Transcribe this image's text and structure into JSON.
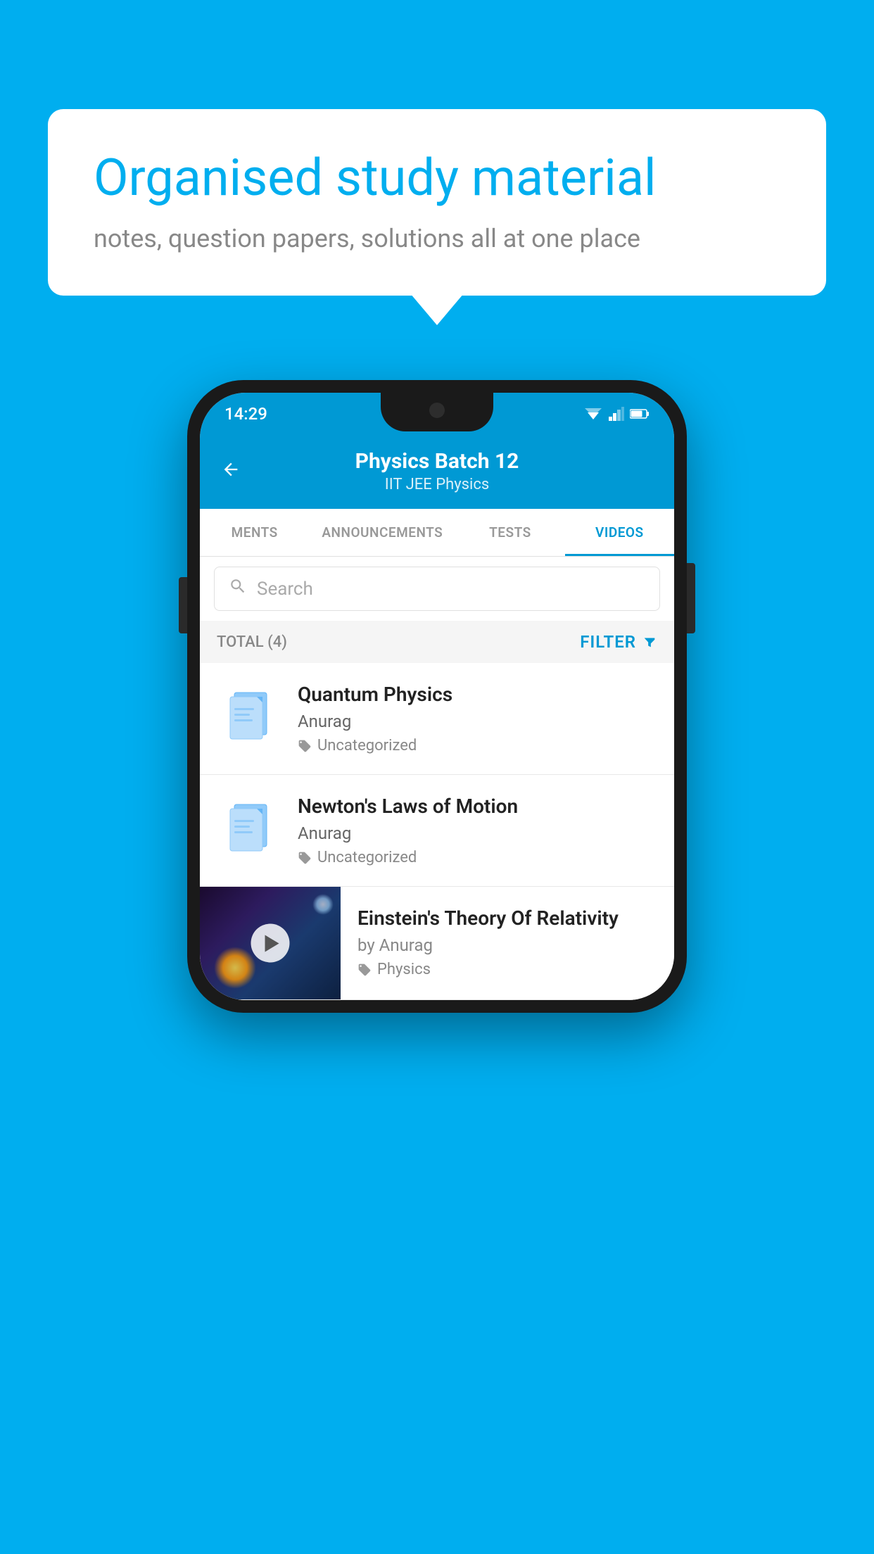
{
  "background_color": "#00AEEF",
  "bubble": {
    "title": "Organised study material",
    "subtitle": "notes, question papers, solutions all at one place"
  },
  "status_bar": {
    "time": "14:29"
  },
  "app_header": {
    "title": "Physics Batch 12",
    "subtitle_parts": [
      "IIT JEE",
      "Physics"
    ],
    "subtitle": "IIT JEE   Physics",
    "back_label": "←"
  },
  "tabs": [
    {
      "label": "MENTS",
      "active": false
    },
    {
      "label": "ANNOUNCEMENTS",
      "active": false
    },
    {
      "label": "TESTS",
      "active": false
    },
    {
      "label": "VIDEOS",
      "active": true
    }
  ],
  "search": {
    "placeholder": "Search"
  },
  "filter_bar": {
    "total_label": "TOTAL (4)",
    "filter_label": "FILTER"
  },
  "video_items": [
    {
      "id": 1,
      "title": "Quantum Physics",
      "author": "Anurag",
      "tag": "Uncategorized",
      "type": "file"
    },
    {
      "id": 2,
      "title": "Newton's Laws of Motion",
      "author": "Anurag",
      "tag": "Uncategorized",
      "type": "file"
    },
    {
      "id": 3,
      "title": "Einstein's Theory Of Relativity",
      "author": "by Anurag",
      "tag": "Physics",
      "type": "video"
    }
  ]
}
